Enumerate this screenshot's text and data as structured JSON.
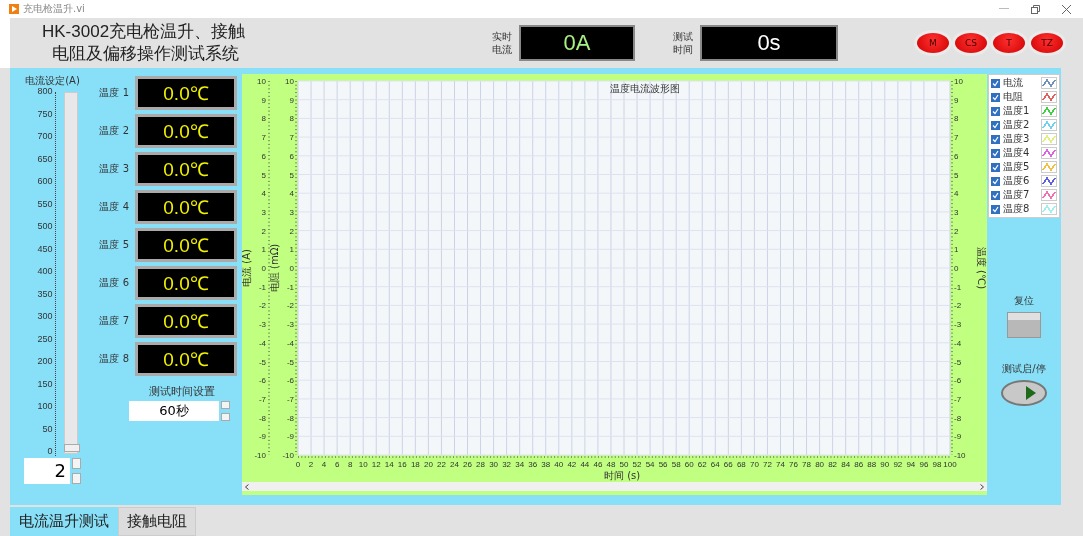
{
  "window": {
    "title": "充电枪温升.vi"
  },
  "header": {
    "title_lines": [
      "HK-3002充电枪温升、接触",
      "电阻及偏移操作测试系统"
    ],
    "readouts": [
      {
        "label": "实时电流",
        "value": "0A",
        "kind": "current"
      },
      {
        "label": "测试时间",
        "value": "0s",
        "kind": "time"
      }
    ],
    "leds": [
      "M",
      "CS",
      "T",
      "TZ"
    ]
  },
  "current_setting": {
    "label": "电流设定(A)",
    "scale": [
      "800",
      "750",
      "700",
      "650",
      "600",
      "550",
      "500",
      "450",
      "400",
      "350",
      "300",
      "250",
      "200",
      "150",
      "100",
      "50",
      "0"
    ],
    "level": 0.0025,
    "value": "2"
  },
  "temperatures": [
    {
      "label": "温度 1",
      "value": "0.0℃"
    },
    {
      "label": "温度 2",
      "value": "0.0℃"
    },
    {
      "label": "温度 3",
      "value": "0.0℃"
    },
    {
      "label": "温度 4",
      "value": "0.0℃"
    },
    {
      "label": "温度 5",
      "value": "0.0℃"
    },
    {
      "label": "温度 6",
      "value": "0.0℃"
    },
    {
      "label": "温度 7",
      "value": "0.0℃"
    },
    {
      "label": "温度 8",
      "value": "0.0℃"
    }
  ],
  "time_setting": {
    "label": "测试时间设置",
    "value": "60秒"
  },
  "plot": {
    "title": "温度电流波形图",
    "x_axis_label": "时间 (s)",
    "left_axis_label": "电流 (A)",
    "second_axis_label": "电阻 (mΩ)",
    "right_axis_label": "温度 (℃)",
    "x_ticks": [
      "0",
      "2",
      "4",
      "6",
      "8",
      "10",
      "12",
      "14",
      "16",
      "18",
      "20",
      "22",
      "24",
      "26",
      "28",
      "30",
      "32",
      "34",
      "36",
      "38",
      "40",
      "42",
      "44",
      "46",
      "48",
      "50",
      "52",
      "54",
      "56",
      "58",
      "60",
      "62",
      "64",
      "66",
      "68",
      "70",
      "72",
      "74",
      "76",
      "78",
      "80",
      "82",
      "84",
      "86",
      "88",
      "90",
      "92",
      "94",
      "96",
      "98",
      "100"
    ],
    "left_axis_ticks": [
      "10",
      "9",
      "8",
      "7",
      "6",
      "5",
      "4",
      "3",
      "2",
      "1",
      "0",
      "-1",
      "-2",
      "-3",
      "-4",
      "-5",
      "-6",
      "-7",
      "-8",
      "-9",
      "-10"
    ],
    "second_axis_ticks": [
      "10",
      "9",
      "8",
      "7",
      "6",
      "5",
      "4",
      "3",
      "2",
      "1",
      "0",
      "-1",
      "-2",
      "-3",
      "-4",
      "-5",
      "-6",
      "-7",
      "-8",
      "-9",
      "-10"
    ],
    "right_axis_ticks": [
      "10",
      "9",
      "8",
      "7",
      "6",
      "5",
      "4",
      "3",
      "2",
      "1",
      "0",
      "-1",
      "-2",
      "-3",
      "-4",
      "-5",
      "-6",
      "-7",
      "-8",
      "-9",
      "-10"
    ],
    "legend": [
      {
        "label": "电流",
        "color": "#7090c0",
        "checked": true
      },
      {
        "label": "电阻",
        "color": "#e06060",
        "checked": true
      },
      {
        "label": "温度1",
        "color": "#40d040",
        "checked": true
      },
      {
        "label": "温度2",
        "color": "#70d0f0",
        "checked": true
      },
      {
        "label": "温度3",
        "color": "#e0f080",
        "checked": true
      },
      {
        "label": "温度4",
        "color": "#e060e0",
        "checked": true
      },
      {
        "label": "温度5",
        "color": "#f0c040",
        "checked": true
      },
      {
        "label": "温度6",
        "color": "#6060e0",
        "checked": true
      },
      {
        "label": "温度7",
        "color": "#f070b0",
        "checked": true
      },
      {
        "label": "温度8",
        "color": "#a0f0f0",
        "checked": true
      }
    ]
  },
  "buttons": [
    {
      "label": "复位",
      "kind": "reset"
    },
    {
      "label": "测试启/停",
      "kind": "start"
    }
  ],
  "tabs": [
    {
      "label": "电流温升测试",
      "selected": true
    },
    {
      "label": "接触电阻",
      "selected": false
    }
  ]
}
